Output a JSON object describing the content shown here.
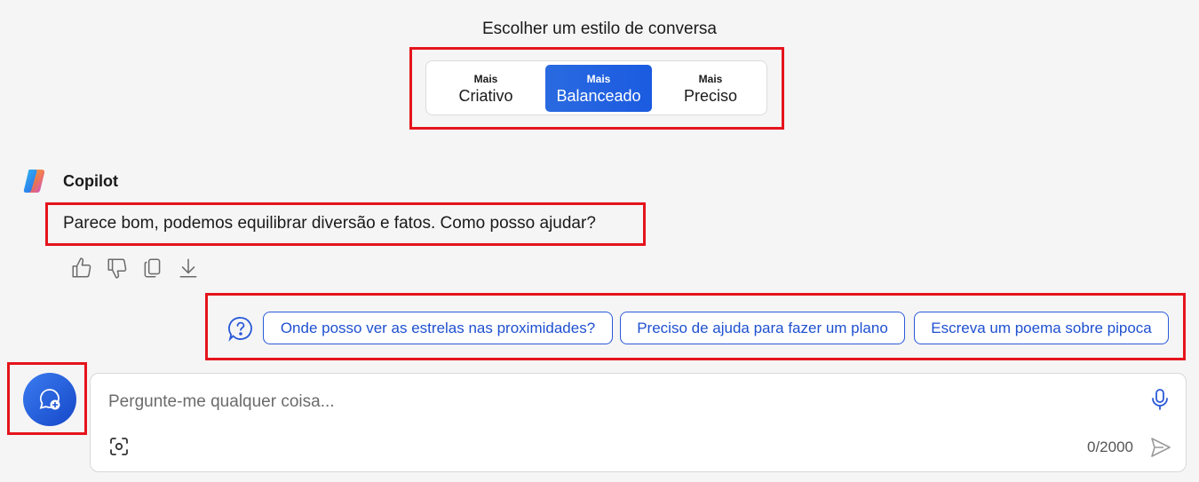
{
  "style_selector": {
    "title": "Escolher um estilo de conversa",
    "options": [
      {
        "small": "Mais",
        "label": "Criativo"
      },
      {
        "small": "Mais",
        "label": "Balanceado",
        "selected": true
      },
      {
        "small": "Mais",
        "label": "Preciso"
      }
    ]
  },
  "message": {
    "author": "Copilot",
    "text": "Parece bom, podemos equilibrar diversão e fatos. Como posso ajudar?",
    "actions": [
      "thumbs-up-icon",
      "thumbs-down-icon",
      "copy-icon",
      "download-icon"
    ]
  },
  "suggestions": {
    "icon": "question-bubble-icon",
    "chips": [
      "Onde posso ver as estrelas nas proximidades?",
      "Preciso de ajuda para fazer um plano",
      "Escreva um poema sobre pipoca"
    ]
  },
  "input": {
    "placeholder": "Pergunte-me qualquer coisa...",
    "char_count": "0/2000"
  },
  "colors": {
    "accent": "#1b5be0",
    "highlight": "#e5141c",
    "chip_text": "#1e50d0"
  }
}
